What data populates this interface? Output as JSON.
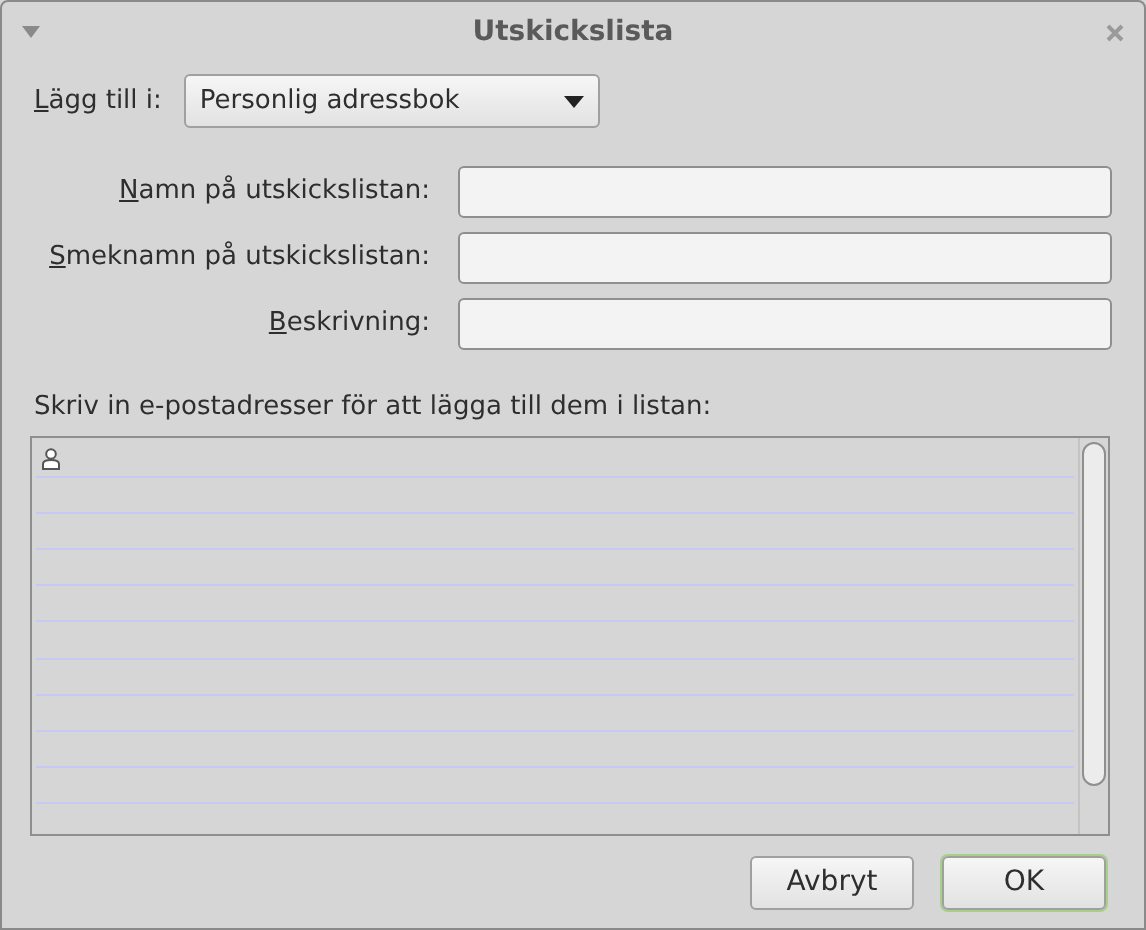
{
  "window": {
    "title": "Utskickslista"
  },
  "add_to": {
    "label": "Lägg till i:",
    "underline_first": true,
    "value": "Personlig adressbok"
  },
  "fields": [
    {
      "label": "Namn på utskickslistan:",
      "underline_first": true
    },
    {
      "label": "Smeknamn på utskickslistan:",
      "underline_first": true
    },
    {
      "label": "Beskrivning:",
      "underline_first": true
    }
  ],
  "address_list": {
    "label": "Skriv in e-postadresser för att lägga till dem i listan:"
  },
  "buttons": [
    {
      "label": "Avbryt",
      "default": false
    },
    {
      "label": "OK",
      "default": true
    }
  ]
}
